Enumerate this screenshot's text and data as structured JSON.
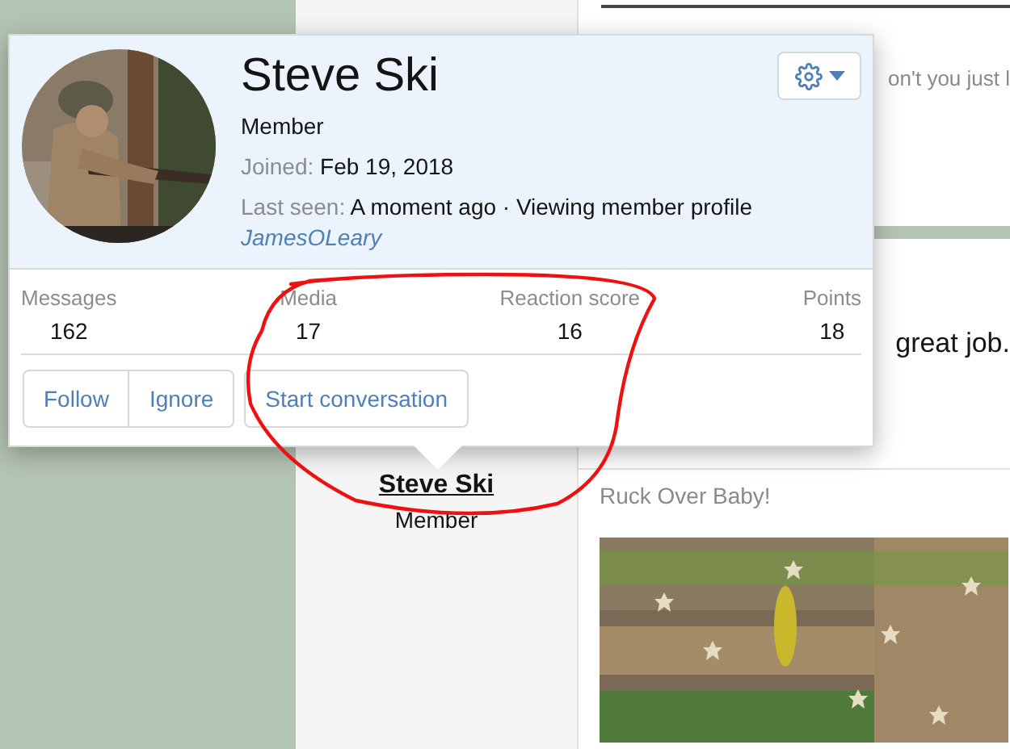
{
  "popup": {
    "name": "Steve Ski",
    "role": "Member",
    "joined_label": "Joined:",
    "joined": "Feb 19, 2018",
    "last_seen_label": "Last seen:",
    "last_seen": "A moment ago · Viewing member profile",
    "username": "JamesOLeary",
    "stats": [
      {
        "label": "Messages",
        "value": "162"
      },
      {
        "label": "Media",
        "value": "17"
      },
      {
        "label": "Reaction score",
        "value": "16"
      },
      {
        "label": "Points",
        "value": "18"
      }
    ],
    "button_group": [
      "Follow",
      "Ignore"
    ],
    "buttons": [
      "Start conversation"
    ]
  },
  "post": {
    "author": "Steve Ski",
    "role": "Member",
    "snippet_top": "on't you just l",
    "snippet_body": "great job.",
    "signature": "Ruck Over Baby!"
  }
}
